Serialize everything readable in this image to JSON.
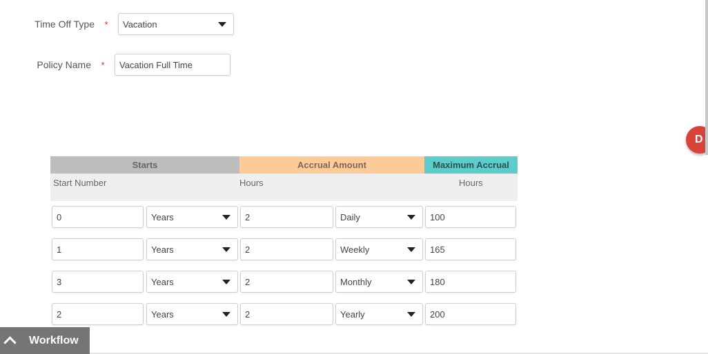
{
  "form": {
    "time_off_type_label": "Time Off Type",
    "time_off_type_value": "Vacation",
    "policy_name_label": "Policy Name",
    "policy_name_value": "Vacation Full Time",
    "required_marker": "*"
  },
  "table": {
    "headers": {
      "starts": "Starts",
      "accrual": "Accrual Amount",
      "maximum": "Maximum Accrual"
    },
    "subheaders": {
      "start_number": "Start Number",
      "hours": "Hours",
      "max_hours": "Hours"
    },
    "rows": [
      {
        "start": "0",
        "unit": "Years",
        "amount": "2",
        "frequency": "Daily",
        "max": "100"
      },
      {
        "start": "1",
        "unit": "Years",
        "amount": "2",
        "frequency": "Weekly",
        "max": "165"
      },
      {
        "start": "3",
        "unit": "Years",
        "amount": "2",
        "frequency": "Monthly",
        "max": "180"
      },
      {
        "start": "2",
        "unit": "Years",
        "amount": "2",
        "frequency": "Yearly",
        "max": "200"
      }
    ]
  },
  "fab": {
    "label": "D"
  },
  "workflow": {
    "label": "Workflow"
  },
  "colors": {
    "starts_header": "#bdbdbd",
    "accrual_header": "#fdca98",
    "maximum_header": "#5dcdcb",
    "required": "#d9302a",
    "fab": "#d9443a"
  }
}
